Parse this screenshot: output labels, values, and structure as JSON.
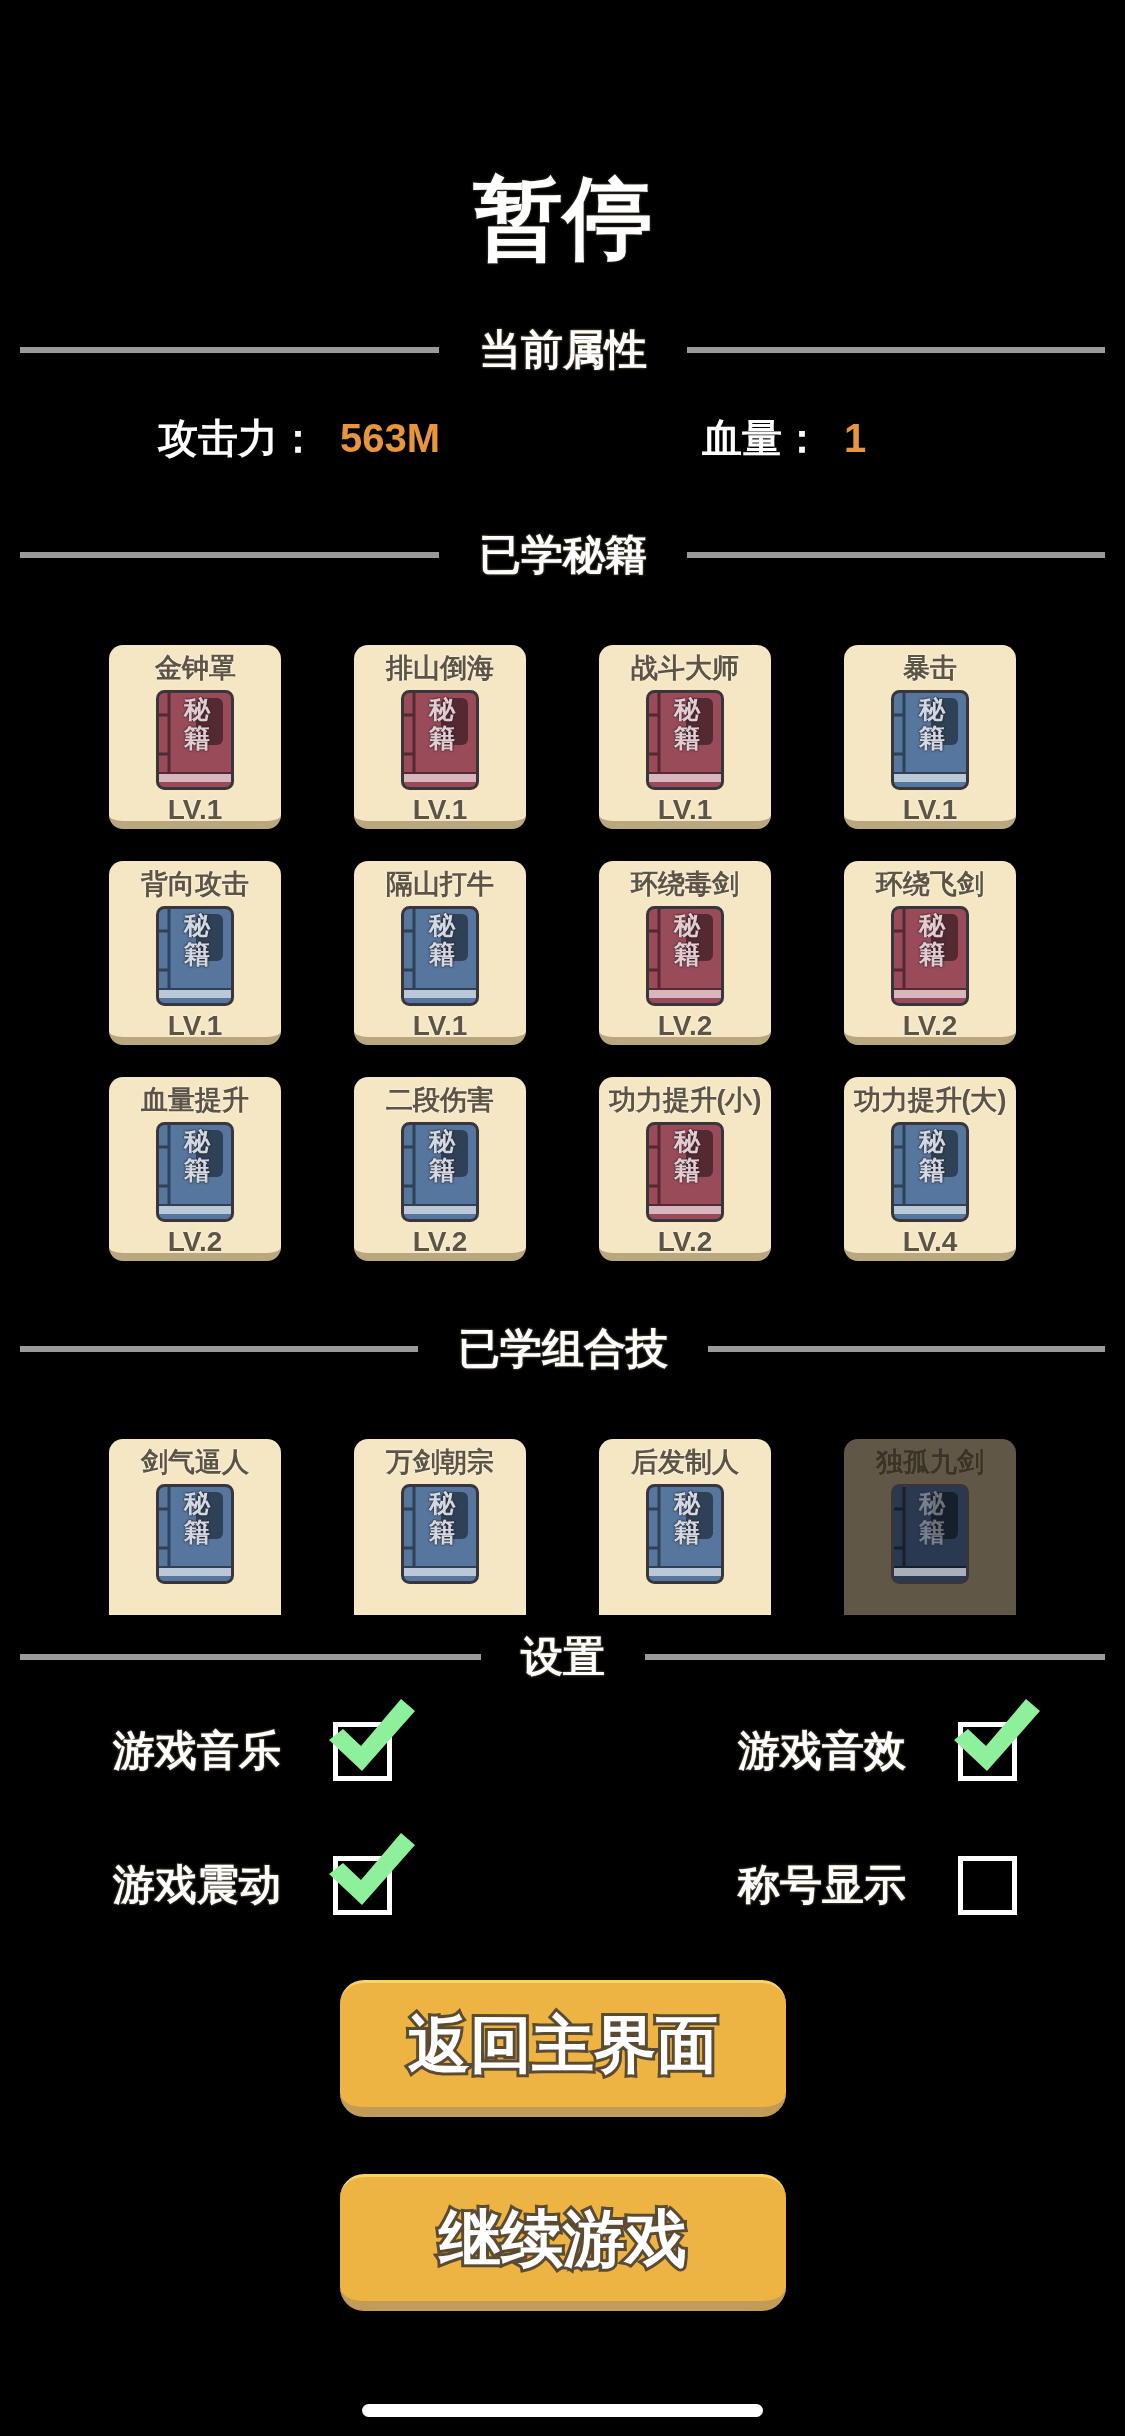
{
  "title": "暂停",
  "attributes_section": {
    "heading": "当前属性",
    "stats": [
      {
        "label": "攻击力：",
        "value": "563M"
      },
      {
        "label": "血量：",
        "value": "1"
      }
    ]
  },
  "skills_section": {
    "heading": "已学秘籍",
    "skills": [
      {
        "name": "金钟罩",
        "cover": "秘籍",
        "color": "#9a4b5a",
        "level": "LV.1"
      },
      {
        "name": "排山倒海",
        "cover": "秘籍",
        "color": "#9a4b5a",
        "level": "LV.1"
      },
      {
        "name": "战斗大师",
        "cover": "秘籍",
        "color": "#9a4b5a",
        "level": "LV.1"
      },
      {
        "name": "暴击",
        "cover": "秘籍",
        "color": "#56769d",
        "level": "LV.1"
      },
      {
        "name": "背向攻击",
        "cover": "秘籍",
        "color": "#56769d",
        "level": "LV.1"
      },
      {
        "name": "隔山打牛",
        "cover": "秘籍",
        "color": "#56769d",
        "level": "LV.1"
      },
      {
        "name": "环绕毒剑",
        "cover": "秘籍",
        "color": "#9a4b5a",
        "level": "LV.2"
      },
      {
        "name": "环绕飞剑",
        "cover": "秘籍",
        "color": "#9a4b5a",
        "level": "LV.2"
      },
      {
        "name": "血量提升",
        "cover": "秘籍",
        "color": "#56769d",
        "level": "LV.2"
      },
      {
        "name": "二段伤害",
        "cover": "秘籍",
        "color": "#56769d",
        "level": "LV.2"
      },
      {
        "name": "功力提升(小)",
        "cover": "秘籍",
        "color": "#9a4b5a",
        "level": "LV.2"
      },
      {
        "name": "功力提升(大)",
        "cover": "秘籍",
        "color": "#56769d",
        "level": "LV.4"
      }
    ]
  },
  "combos_section": {
    "heading": "已学组合技",
    "combos": [
      {
        "name": "剑气逼人",
        "cover": "秘籍",
        "color": "#56769d",
        "locked": false
      },
      {
        "name": "万剑朝宗",
        "cover": "秘籍",
        "color": "#56769d",
        "locked": false
      },
      {
        "name": "后发制人",
        "cover": "秘籍",
        "color": "#56769d",
        "locked": false
      },
      {
        "name": "独孤九剑",
        "cover": "秘籍",
        "color": "#2a3850",
        "locked": true
      }
    ]
  },
  "settings_section": {
    "heading": "设置",
    "options": [
      {
        "label": "游戏音乐",
        "checked": true
      },
      {
        "label": "游戏音效",
        "checked": true
      },
      {
        "label": "游戏震动",
        "checked": true
      },
      {
        "label": "称号显示",
        "checked": false
      }
    ]
  },
  "buttons": [
    "返回主界面",
    "继续游戏"
  ]
}
